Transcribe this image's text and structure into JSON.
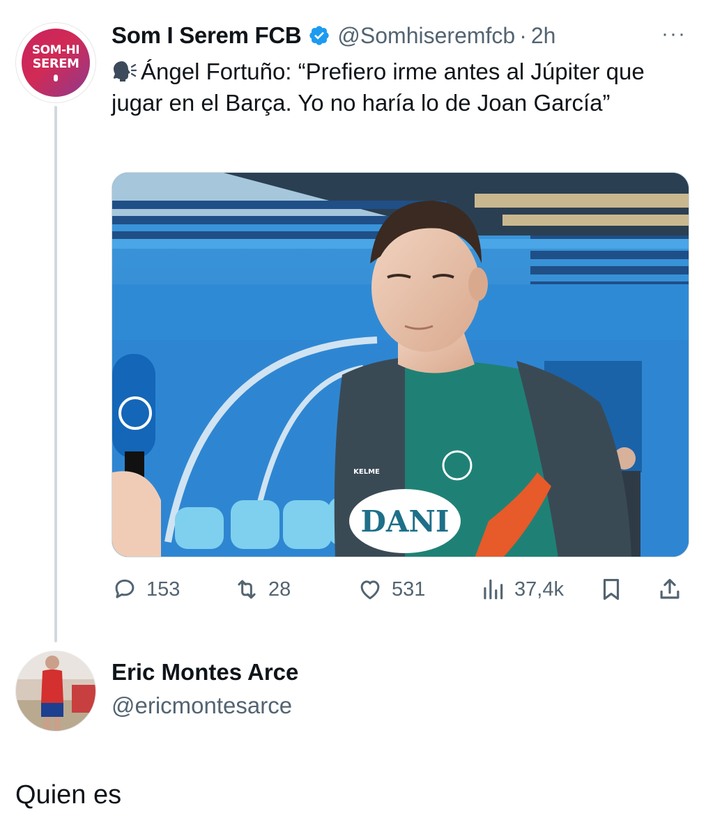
{
  "tweet": {
    "avatar": {
      "line1": "SOM-HI",
      "line2": "SEREM"
    },
    "display_name": "Som I Serem FCB",
    "handle": "@Somhiseremfcb",
    "separator": "·",
    "time": "2h",
    "more_label": "···",
    "text": "Ángel Fortuño: “Prefiero irme antes al Júpiter que jugar en el Barça. Yo no haría lo de Joan García”",
    "media": {
      "sponsor_text": "DANI",
      "brand_text": "KELME"
    },
    "actions": {
      "replies": "153",
      "retweets": "28",
      "likes": "531",
      "views": "37,4k"
    }
  },
  "reply": {
    "display_name": "Eric Montes Arce",
    "handle": "@ericmontesarce",
    "text": "Quien es"
  },
  "colors": {
    "text_primary": "#0f1419",
    "text_secondary": "#536471",
    "verified": "#1d9bf0",
    "thread_line": "#cfd9de"
  },
  "icons": [
    "verified-badge-icon",
    "more-icon",
    "speaking-head-icon",
    "reply-icon",
    "retweet-icon",
    "like-icon",
    "views-icon",
    "bookmark-icon",
    "share-icon"
  ]
}
